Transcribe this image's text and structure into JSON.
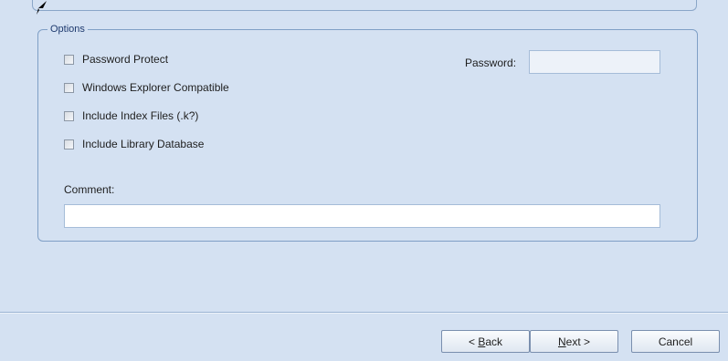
{
  "options": {
    "legend": "Options",
    "checkboxes": [
      {
        "label": "Password Protect",
        "checked": false
      },
      {
        "label": "Windows Explorer Compatible",
        "checked": false
      },
      {
        "label": "Include Index Files (.k?)",
        "checked": false
      },
      {
        "label": "Include Library Database",
        "checked": false
      }
    ],
    "password": {
      "label": "Password:",
      "value": ""
    },
    "comment": {
      "label": "Comment:",
      "value": ""
    }
  },
  "buttons": {
    "back": {
      "prefix": "< ",
      "mnemonic": "B",
      "rest": "ack"
    },
    "next": {
      "mnemonic": "N",
      "rest": "ext >"
    },
    "cancel": {
      "label": "Cancel"
    }
  },
  "icons": {
    "cursor": "mouse-pointer-icon"
  }
}
